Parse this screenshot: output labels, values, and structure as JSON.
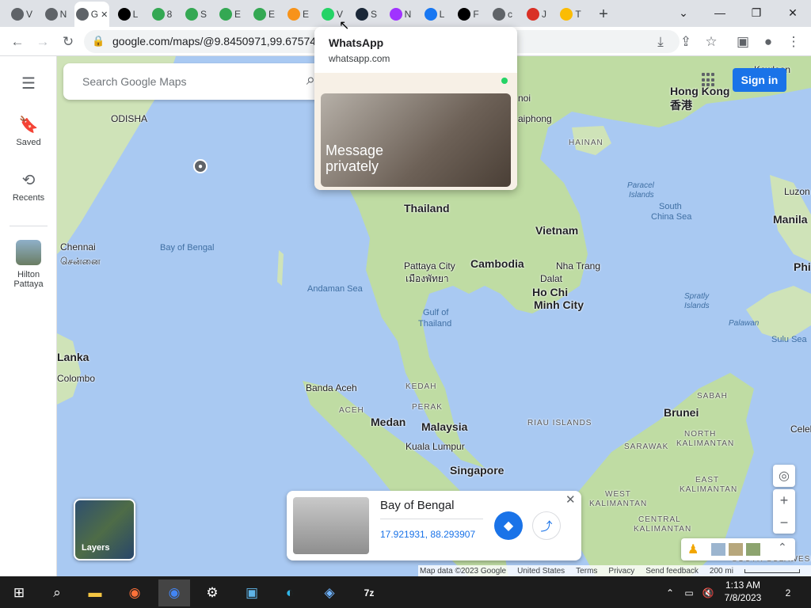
{
  "browser": {
    "tabs": [
      {
        "letter": "V",
        "icon": "chrome-icon",
        "color": "#5f6368"
      },
      {
        "letter": "N",
        "icon": "chrome-icon",
        "color": "#5f6368"
      },
      {
        "letter": "G",
        "icon": "google-maps-tab-icon",
        "color": "#5f6368",
        "active": true
      },
      {
        "letter": "L",
        "icon": "wikipedia-icon",
        "color": "#000000"
      },
      {
        "letter": "8",
        "icon": "google-play-icon",
        "color": "#34a853"
      },
      {
        "letter": "S",
        "icon": "google-play-icon",
        "color": "#34a853"
      },
      {
        "letter": "E",
        "icon": "google-play-icon",
        "color": "#34a853"
      },
      {
        "letter": "E",
        "icon": "google-play-icon",
        "color": "#34a853"
      },
      {
        "letter": "E",
        "icon": "bitcoin-icon",
        "color": "#f7931a"
      },
      {
        "letter": "V",
        "icon": "whatsapp-icon",
        "color": "#25d366"
      },
      {
        "letter": "S",
        "icon": "steam-icon",
        "color": "#1b2838"
      },
      {
        "letter": "N",
        "icon": "messenger-icon",
        "color": "#a033ff"
      },
      {
        "letter": "L",
        "icon": "facebook-icon",
        "color": "#1877f2"
      },
      {
        "letter": "F",
        "icon": "github-icon",
        "color": "#000000"
      },
      {
        "letter": "c",
        "icon": "globe-icon",
        "color": "#5f6368"
      },
      {
        "letter": "J",
        "icon": "red-tile-icon",
        "color": "#d93025"
      },
      {
        "letter": "T",
        "icon": "mail-icon",
        "color": "#fbbc04"
      }
    ],
    "new_tab": "+",
    "url": "google.com/maps/@9.8450971,99.675743"
  },
  "hovercard": {
    "title": "WhatsApp",
    "domain": "whatsapp.com",
    "preview_headline_1": "Message",
    "preview_headline_2": "privately"
  },
  "maps": {
    "search_placeholder": "Search Google Maps",
    "signin": "Sign in",
    "rail": {
      "saved": "Saved",
      "recents": "Recents",
      "recent_place_1": "Hilton",
      "recent_place_2": "Pattaya"
    },
    "labels": {
      "odisha": "ODISHA",
      "chennai": "Chennai",
      "chennai_tamil": "சென்னை",
      "bay_of_bengal": "Bay of Bengal",
      "andaman_sea": "Andaman Sea",
      "lanka": "Lanka",
      "colombo": "Colombo",
      "thailand": "Thailand",
      "vietnam": "Vietnam",
      "cambodia": "Cambodia",
      "pattaya": "Pattaya City",
      "pattaya_thai": "เมืองพัทยา",
      "nha_trang": "Nha Trang",
      "dalat": "Dalat",
      "hcmc_1": "Ho Chi",
      "hcmc_2": "Minh City",
      "gulf_1": "Gulf of",
      "gulf_2": "Thailand",
      "hong_kong": "Hong Kong",
      "hong_kong_cn": "香港",
      "hainan": "HAINAN",
      "haiphong": "aiphong",
      "hanoi": "noi",
      "paracel_1": "Paracel",
      "paracel_2": "Islands",
      "scs_1": "South",
      "scs_2": "China Sea",
      "luzon": "Luzon",
      "manila": "Manila",
      "phi": "Phi",
      "spratly_1": "Spratly",
      "spratly_2": "Islands",
      "palawan": "Palawan",
      "sulu": "Sulu Sea",
      "banda_aceh": "Banda Aceh",
      "aceh": "ACEH",
      "kedah": "KEDAH",
      "perak": "PERAK",
      "medan": "Medan",
      "malaysia": "Malaysia",
      "kuala_lumpur": "Kuala Lumpur",
      "singapore": "Singapore",
      "riau": "RIAU ISLANDS",
      "brunei": "Brunei",
      "sabah": "SABAH",
      "n_kal_1": "NORTH",
      "n_kal_2": "KALIMANTAN",
      "sarawak": "SARAWAK",
      "w_kal_1": "WEST",
      "w_kal_2": "KALIMANTAN",
      "c_kal_1": "CENTRAL",
      "c_kal_2": "KALIMANTAN",
      "e_kal_1": "EAST",
      "e_kal_2": "KALIMANTAN",
      "celeb": "Celeb",
      "kowloon": "Kowloon",
      "s_sulawesi": "SOUTH SULAWESI"
    },
    "placecard": {
      "title": "Bay of Bengal",
      "coords": "17.921931, 88.293907"
    },
    "layers_label": "Layers",
    "footer": {
      "map_data": "Map data ©2023 Google",
      "country": "United States",
      "terms": "Terms",
      "privacy": "Privacy",
      "feedback": "Send feedback",
      "scale": "200 mi"
    }
  },
  "taskbar": {
    "time": "1:13 AM",
    "date": "7/8/2023",
    "notifications": "2"
  }
}
